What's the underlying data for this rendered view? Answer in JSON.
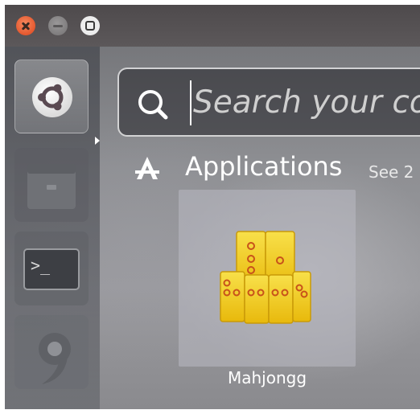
{
  "window_controls": {
    "close": "close-icon",
    "minimize": "minimize-icon",
    "maximize": "maximize-icon"
  },
  "launcher": {
    "items": [
      {
        "name": "dash-home",
        "icon": "ubuntu-logo-icon",
        "active": true
      },
      {
        "name": "files",
        "icon": "file-cabinet-icon"
      },
      {
        "name": "terminal",
        "icon": "terminal-icon",
        "glyph": ">_"
      },
      {
        "name": "unknown",
        "icon": "swirl-icon"
      }
    ]
  },
  "search": {
    "placeholder": "Search your com",
    "icon": "search-icon"
  },
  "category": {
    "icon": "applications-icon",
    "title": "Applications",
    "see_more": "See 2"
  },
  "results": [
    {
      "label": "Mahjongg",
      "icon": "mahjongg-icon"
    }
  ],
  "colors": {
    "close": "#e4572e",
    "tile_yellow": "#f4d11e",
    "tile_dot": "#c8521a"
  }
}
